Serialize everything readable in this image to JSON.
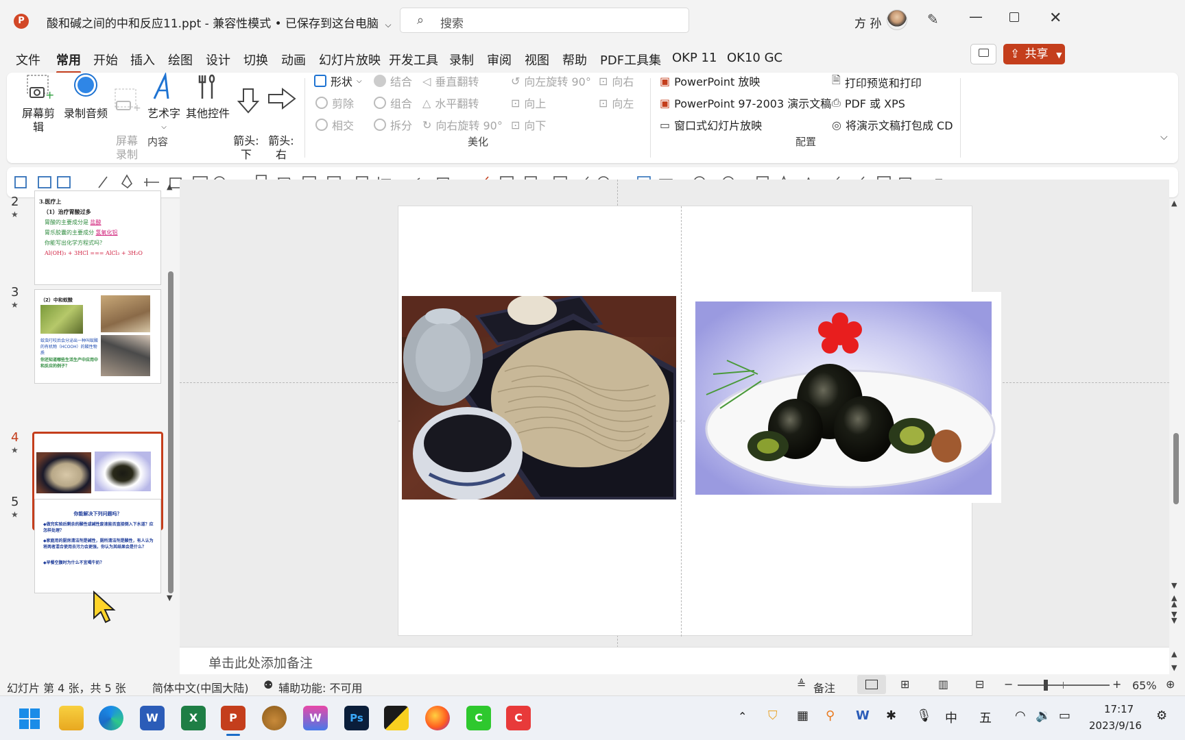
{
  "window": {
    "title": "酸和碱之间的中和反应11.ppt  -  兼容性模式 • 已保存到这台电脑",
    "search_placeholder": "搜索",
    "user_name": "方 孙"
  },
  "menu": {
    "items": [
      "文件",
      "常用",
      "开始",
      "插入",
      "绘图",
      "设计",
      "切换",
      "动画",
      "幻灯片放映",
      "开发工具",
      "录制",
      "审阅",
      "视图",
      "帮助",
      "PDF工具集",
      "OKP 11",
      "OK10 GC"
    ],
    "share_label": "共享"
  },
  "ribbon": {
    "content_group": {
      "label": "内容",
      "buttons": [
        "屏幕剪辑",
        "录制音频",
        "屏幕\n录制",
        "艺术字",
        "其他控件",
        "箭头:\n下",
        "箭头:\n右"
      ]
    },
    "beautify_group": {
      "label": "美化",
      "col1": [
        "形状",
        "剪除",
        "相交"
      ],
      "col2": [
        "结合",
        "组合",
        "拆分"
      ],
      "col3": [
        "垂直翻转",
        "水平翻转",
        "向右旋转 90°"
      ],
      "col4": [
        "向左旋转 90°",
        "向上",
        "向下"
      ],
      "col5": [
        "向右",
        "向左"
      ]
    },
    "config_group": {
      "label": "配置",
      "col1": [
        "PowerPoint 放映",
        "PowerPoint 97-2003 演示文稿",
        "窗口式幻灯片放映"
      ],
      "col2": [
        "打印预览和打印",
        "PDF 或 XPS",
        "将演示文稿打包成 CD"
      ]
    }
  },
  "thumbnails": [
    {
      "num": "2",
      "lines": [
        "3.医疗上",
        "（1）治疗胃酸过多",
        "胃酸的主要成分是",
        "盐酸",
        "胃乐胶囊的主要成分",
        "氢氧化铝",
        "你能写出化学方程式吗？",
        "Al(OH)₃ + 3HCl === AlCl₃ + 3H₂O"
      ]
    },
    {
      "num": "3",
      "lines": [
        "（2）中和蚁酸",
        "蚊虫叮咬后会分泌出一种叫蚁酸的有机物（HCOOH）的酸性物质",
        "你还知道哪些生活生产中应用中和反应的例子？"
      ]
    },
    {
      "num": "4"
    },
    {
      "num": "5",
      "lines": [
        "你能解决下列问题吗？",
        "◆做完实验后剩余的酸性或碱性废液能否直接倒入下水道？应怎样处理？",
        "◆家庭用的厨房清洁剂是碱性，厕所清洁剂是酸性，有人认为将两者混合使用去污力会更强，你认为其结果会是什么？",
        "◆早餐空腹时为什么不宜喝牛奶？"
      ]
    }
  ],
  "notes": {
    "placeholder": "单击此处添加备注"
  },
  "status": {
    "slide_info": "幻灯片 第 4 张，共 5 张",
    "language": "简体中文(中国大陆)",
    "accessibility": "辅助功能: 不可用",
    "notes_label": "备注",
    "zoom": "65%"
  },
  "taskbar": {
    "time": "17:17",
    "date": "2023/9/16",
    "ime1": "中",
    "ime2": "五"
  },
  "colors": {
    "accent": "#c43e1c",
    "ribbon_bg": "#ffffff",
    "app_bg": "#f3f3f3"
  }
}
